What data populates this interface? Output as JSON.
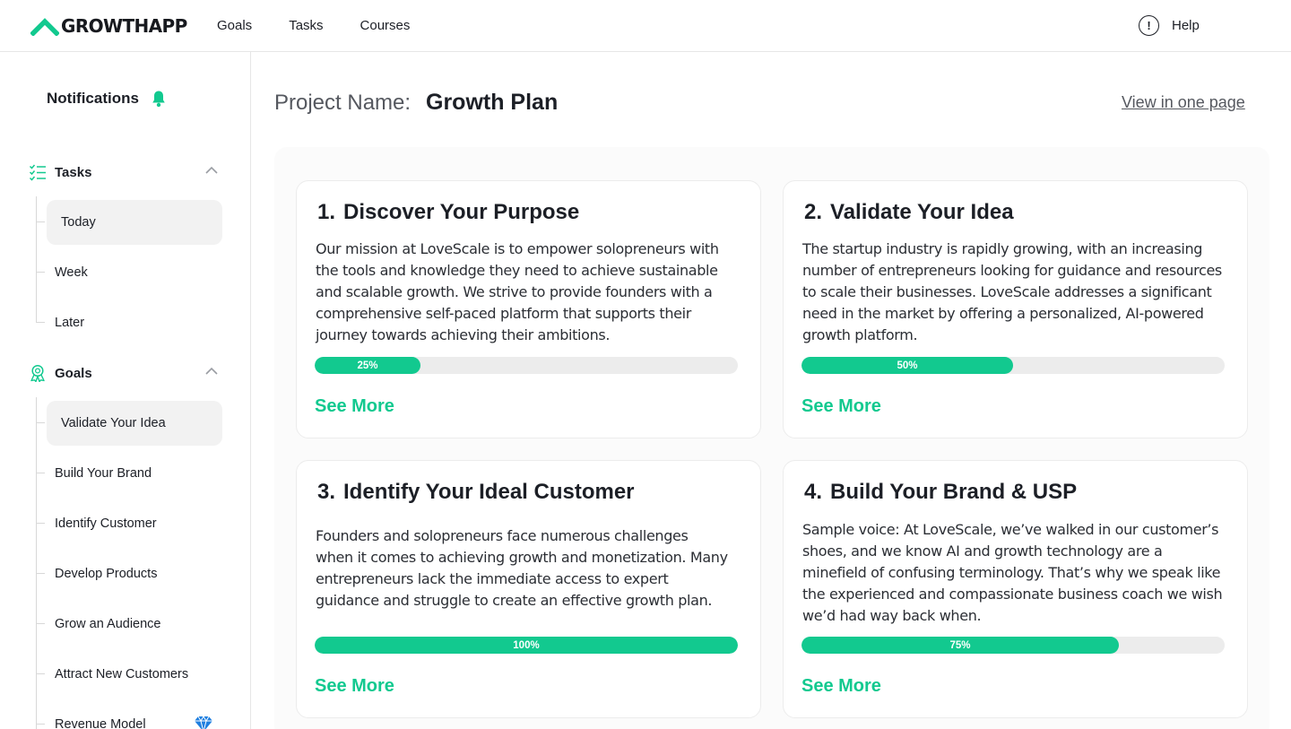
{
  "colors": {
    "accent": "#12c98f",
    "progress_track": "#ececec",
    "text": "#1c1f26",
    "muted": "#55585f"
  },
  "brand": {
    "name": "GROWTHAPP",
    "logo_icon": "chevron-up-logo-icon"
  },
  "nav": {
    "items": [
      {
        "label": "Goals"
      },
      {
        "label": "Tasks"
      },
      {
        "label": "Courses"
      }
    ]
  },
  "help": {
    "icon": "exclamation-circle-icon",
    "label": "Help"
  },
  "sidebar": {
    "notifications": {
      "label": "Notifications",
      "icon": "bell-icon"
    },
    "tasks": {
      "label": "Tasks",
      "icon": "checklist-icon",
      "expanded": true,
      "items": [
        {
          "label": "Today",
          "active": true
        },
        {
          "label": "Week"
        },
        {
          "label": "Later"
        }
      ]
    },
    "goals": {
      "label": "Goals",
      "icon": "award-icon",
      "expanded": true,
      "items": [
        {
          "label": "Validate Your Idea",
          "active": true
        },
        {
          "label": "Build Your Brand"
        },
        {
          "label": "Identify Customer"
        },
        {
          "label": "Develop Products"
        },
        {
          "label": "Grow an Audience"
        },
        {
          "label": "Attract New Customers"
        },
        {
          "label": "Revenue Model",
          "badge_icon": "diamond-icon"
        }
      ]
    }
  },
  "project": {
    "label": "Project Name:",
    "name": "Growth Plan",
    "view_link": "View in one page"
  },
  "cards": [
    {
      "number": "1.",
      "title": "Discover Your Purpose",
      "body": "Our mission at LoveScale is to empower solopreneurs with the tools and knowledge they need to achieve sustainable and scalable growth. We strive to provide founders with a comprehensive self-paced platform that supports their journey towards achieving their ambitions.",
      "progress": 25,
      "progress_label": "25%",
      "cta": "See More"
    },
    {
      "number": "2.",
      "title": "Validate Your Idea",
      "body": "The startup industry is rapidly growing, with an increasing number of entrepreneurs looking for guidance and resources to scale their businesses. LoveScale addresses a significant need in the market by offering a personalized, AI-powered growth platform.",
      "progress": 50,
      "progress_label": "50%",
      "cta": "See More"
    },
    {
      "number": "3.",
      "title": "Identify Your Ideal Customer",
      "body": "Founders and solopreneurs face numerous challenges when it comes to achieving growth and monetization. Many entrepreneurs lack the immediate access to expert guidance and struggle to create an effective growth plan.",
      "progress": 100,
      "progress_label": "100%",
      "cta": "See More"
    },
    {
      "number": "4.",
      "title": "Build Your Brand & USP",
      "body": "Sample voice: At LoveScale, we’ve walked in our customer’s shoes, and we know AI and growth technology are a minefield of confusing terminology. That’s why we speak like the experienced and compassionate business coach we wish we’d had way back when.",
      "progress": 75,
      "progress_label": "75%",
      "cta": "See More"
    }
  ]
}
